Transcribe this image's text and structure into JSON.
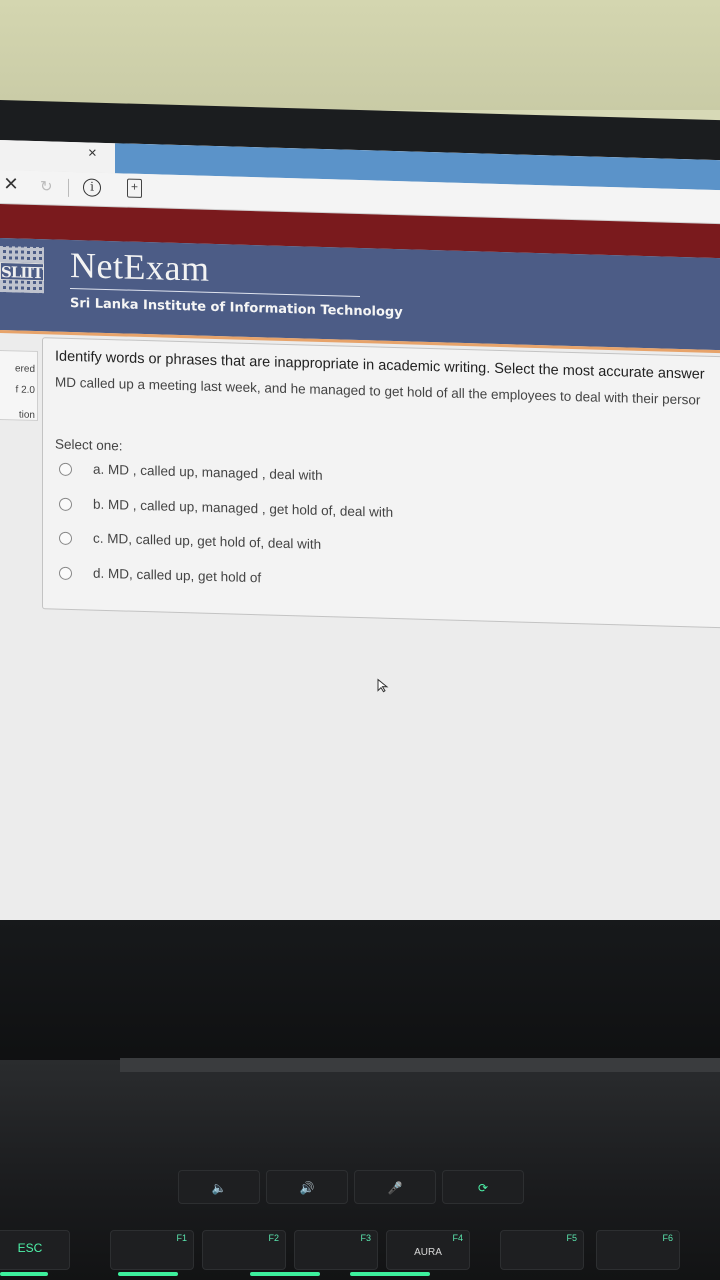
{
  "browser": {
    "tab_close": "×",
    "stop_icon": "×",
    "reload_icon": "↻",
    "info_icon": "i",
    "page_icon": "+"
  },
  "site": {
    "logo_text": "SLIIT",
    "title": "NetExam",
    "subtitle": "Sri Lanka Institute of Information Technology"
  },
  "sidebar": {
    "line1": "ered",
    "line2": "f 2.0",
    "line3": "tion"
  },
  "question": {
    "title": "Identify words or phrases that are inappropriate in academic writing. Select the most accurate answer",
    "text": "MD called up a meeting last week, and he managed to get hold of all the employees to deal with their persor",
    "select_label": "Select one:",
    "options": [
      {
        "label": "a. MD , called up, managed , deal with",
        "selected": false
      },
      {
        "label": "b. MD , called up, managed , get hold of, deal with",
        "selected": false
      },
      {
        "label": "c. MD, called up, get hold of, deal with",
        "selected": false
      },
      {
        "label": "d. MD, called up, get hold of",
        "selected": false
      }
    ]
  },
  "keyboard": {
    "esc": "ESC",
    "media_keys": [
      "🔈",
      "🔊",
      "🎤",
      "⟳"
    ],
    "fkeys": [
      {
        "num": "F1",
        "name": ""
      },
      {
        "num": "F2",
        "name": ""
      },
      {
        "num": "F3",
        "name": ""
      },
      {
        "num": "F4",
        "name": "AURA"
      },
      {
        "num": "F5",
        "name": ""
      },
      {
        "num": "F6",
        "name": ""
      }
    ]
  },
  "colors": {
    "red_bar": "#7a1a1d",
    "header": "#4c5c86",
    "accent_line": "#e7a36a",
    "tab_blue": "#5b93c9",
    "key_glow": "#3df09d"
  }
}
